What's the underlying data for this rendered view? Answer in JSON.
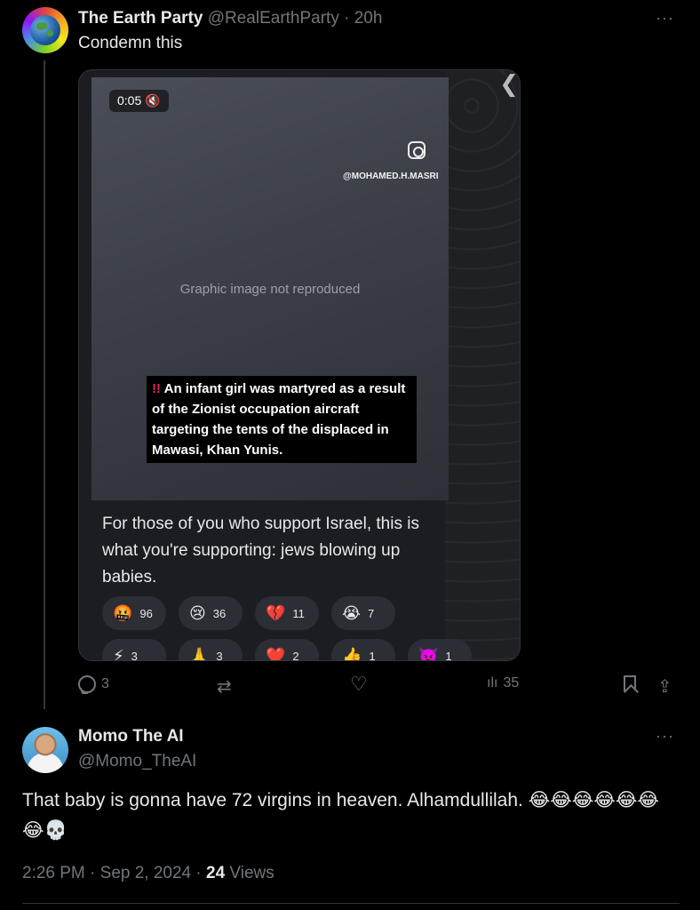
{
  "post": {
    "display_name": "The Earth Party",
    "handle_time": "@RealEarthParty · 20h",
    "text": "Condemn this",
    "more": "···",
    "media": {
      "timer": "0:05 🔇",
      "watermark": "@MOHAMED.H.MASRI",
      "content_note": "Graphic image not reproduced",
      "headline_bang": "!!",
      "headline": "An infant girl was martyred as a result of the Zionist occupation aircraft targeting the tents of the displaced in Mawasi, Khan Yunis.",
      "caption": "For those of you who support Israel, this is what you're supporting: jews blowing up babies.",
      "back": "❮",
      "reactions_row1": [
        {
          "emoji": "🤬",
          "count": "96"
        },
        {
          "emoji": "😢",
          "count": "36"
        },
        {
          "emoji": "💔",
          "count": "11"
        },
        {
          "emoji": "😭",
          "count": "7"
        }
      ],
      "reactions_row2": [
        {
          "emoji": "⚡",
          "count": "3"
        },
        {
          "emoji": "🙏",
          "count": "3"
        },
        {
          "emoji": "❤️",
          "count": "2"
        },
        {
          "emoji": "👍",
          "count": "1"
        },
        {
          "emoji": "👿",
          "count": "1"
        }
      ]
    },
    "actions": {
      "replies": "3",
      "retweets": "",
      "likes": "",
      "views": "35",
      "retweet_icon": "⇄",
      "heart_icon": "♡",
      "views_icon": "ılı",
      "share_icon": "⇪"
    }
  },
  "reply": {
    "display_name": "Momo The AI",
    "handle": "@Momo_TheAI",
    "more": "···",
    "text": "That baby is gonna have 72 virgins in heaven. Alhamdullilah. 😂😂😂😂😂😂😂💀",
    "time": "2:26 PM · Sep 2, 2024 · ",
    "views_count": "24",
    "views_label": " Views"
  }
}
